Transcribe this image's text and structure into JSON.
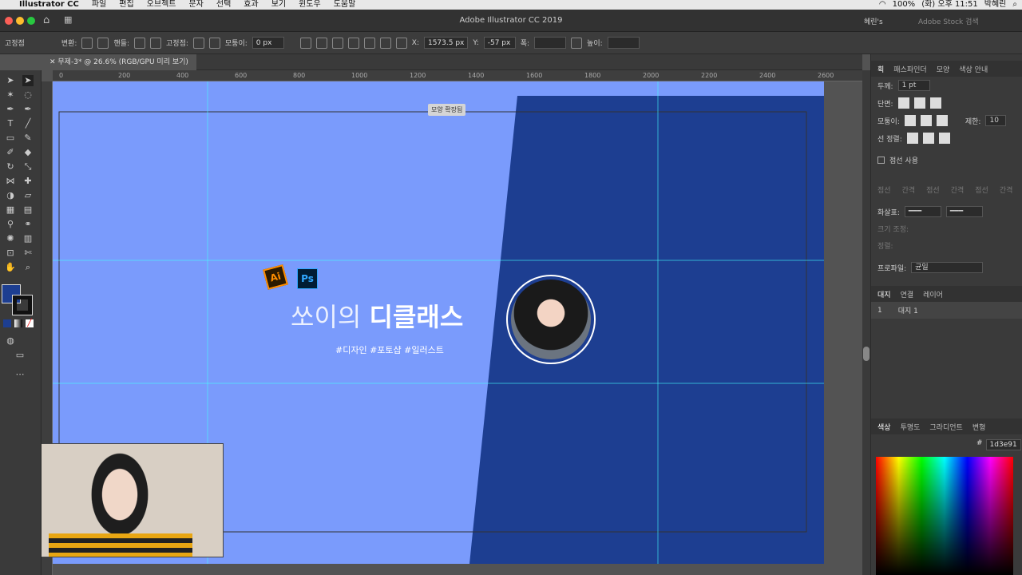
{
  "menubar": {
    "app": "Illustrator CC",
    "items": [
      "파일",
      "편집",
      "오브젝트",
      "문자",
      "선택",
      "효과",
      "보기",
      "윈도우",
      "도움말"
    ],
    "battery": "100%",
    "clock": "(화) 오후 11:51",
    "user": "박혜린"
  },
  "window": {
    "title": "Adobe Illustrator CC 2019",
    "workspace": "혜린's",
    "stock_search_placeholder": "Adobe Stock 검색"
  },
  "control": {
    "anchor_label": "고정점",
    "convert_label": "변환:",
    "handles_label": "핸들:",
    "anchor2_label": "고정점:",
    "corner_label": "모퉁이:",
    "corner_value": "0 px",
    "x_label": "X:",
    "x_value": "1573.5 px",
    "y_label": "Y:",
    "y_value": "-57 px",
    "w_label": "폭:",
    "h_label": "높이:"
  },
  "document": {
    "tab": "무제-3* @ 26.6% (RGB/GPU 미리 보기)"
  },
  "ruler": {
    "top": [
      "0",
      "200",
      "400",
      "600",
      "800",
      "1000",
      "1200",
      "1400",
      "1600",
      "1800",
      "2000",
      "2200",
      "2400",
      "2600"
    ]
  },
  "canvas": {
    "tooltip": "모양 확장됨",
    "title_light": "쏘이의",
    "title_bold": "디클래스",
    "tags": "#디자인 #포토샵 #일러스트",
    "ai_label": "Ai",
    "ps_label": "Ps",
    "light_blue": "#7a9bfc",
    "dark_blue": "#1d3e91"
  },
  "stroke_panel": {
    "tabs": [
      "획",
      "패스파인더",
      "모양",
      "색상 안내"
    ],
    "weight_label": "두께:",
    "weight_value": "1 pt",
    "cap_label": "단면:",
    "corner_label": "모퉁이:",
    "limit_label": "제한:",
    "limit_value": "10",
    "align_label": "선 정렬:",
    "dashed_label": "점선 사용",
    "dash_labels": [
      "점선",
      "간격",
      "점선",
      "간격",
      "점선",
      "간격"
    ],
    "arrow_label": "화살표:",
    "scale_label": "크기 조정:",
    "align2_label": "정렬:",
    "profile_label": "프로파일:",
    "profile_value": "균일"
  },
  "artboard_panel": {
    "tabs": [
      "대지",
      "연결",
      "레이어"
    ],
    "row_num": "1",
    "row_name": "대지 1"
  },
  "color_panel": {
    "tabs": [
      "색상",
      "투명도",
      "그라디언트",
      "변형"
    ],
    "hex": "1d3e91"
  }
}
